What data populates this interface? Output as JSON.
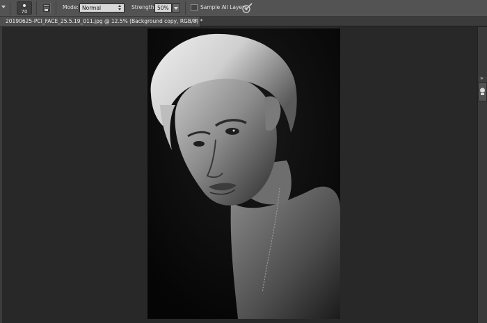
{
  "options_bar": {
    "brush_size": "70",
    "mode_label": "Mode:",
    "mode_value": "Normal",
    "strength_label": "Strength:",
    "strength_value": "50%",
    "sample_all_layers_label": "Sample All Layers",
    "sample_all_layers_checked": false,
    "icons": [
      "tool-preset-dropdown-icon",
      "brush-preset-icon",
      "brush-panel-toggle-icon",
      "pressure-brush-icon"
    ]
  },
  "document_tab": {
    "title": "20190625-PCI_FACE_25.5.19_011.jpg @ 12.5% (Background copy, RGB/8) *",
    "close_icon": "×"
  },
  "canvas": {
    "image_description": "black and white portrait photograph"
  },
  "colors": {
    "options_bar_bg": "#535353",
    "workspace_bg": "#282828",
    "tab_bg": "#4f4f4f"
  }
}
